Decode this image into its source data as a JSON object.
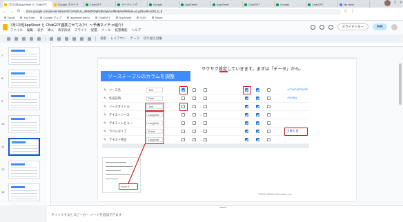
{
  "browser": {
    "tabs": [
      {
        "label": "7月13日]AppSheet と ChatGPT",
        "color": "#f4b400",
        "active": true
      },
      {
        "label": "Google スライド",
        "color": "#fbbc04",
        "active": false
      },
      {
        "label": "ChatGPT",
        "color": "#0f9d58",
        "active": false
      },
      {
        "label": "ライティング",
        "color": "#0f9d58",
        "active": false
      },
      {
        "label": "Google",
        "color": "#0f9d58",
        "active": false
      },
      {
        "label": "AppSheet",
        "color": "#0f9d58",
        "active": false
      },
      {
        "label": "AppSheet",
        "color": "#0f9d58",
        "active": false
      },
      {
        "label": "ChatGPT",
        "color": "#0f9d58",
        "active": false
      },
      {
        "label": "Google",
        "color": "#0f9d58",
        "active": false
      },
      {
        "label": "ChatGPT",
        "color": "#0f9d58",
        "active": false
      },
      {
        "label": "My drive",
        "color": "#4285f4",
        "active": false
      }
    ],
    "url": "docs.google.com/presentation/d/1nAM4Uv_aBWZ8DpRdbnhjaAo0f8nB/edit#slide=id.g25ce9c4c0d_0_5",
    "bookmarks": [
      "Gmail",
      "YouTube",
      "Google マップ",
      "appsheet-demo",
      "ChatGPT",
      "AppSheet",
      "GAS",
      "Slides"
    ]
  },
  "app": {
    "doc_title": "7月13日]AppSheet と ChatGPT連携させてみた！〜予備ネイチャ紹介！",
    "menus": [
      "ファイル",
      "編集",
      "表示",
      "挿入",
      "表示形式",
      "スライド",
      "配置",
      "ツール",
      "拡張機能",
      "ヘルプ"
    ],
    "slideshow_label": "スライドショー",
    "share_label": "共有",
    "toolbar_items": [
      "背景",
      "レイアウト",
      "テーマ",
      "切り替え効果"
    ]
  },
  "filmstrip": {
    "slide_numbers": [
      "7",
      "8",
      "9",
      "10",
      "11",
      "12",
      "13"
    ],
    "selected": "11"
  },
  "slide": {
    "headline": "サクサク設定していきます。まずは「データ」から。",
    "banner": "ソーステーブルのカラムを調整",
    "rows": [
      {
        "name": "ソース名",
        "type": "Text",
        "checks": [
          true,
          false,
          false,
          true,
          true,
          false
        ],
        "tail": "=CONCATENATE"
      },
      {
        "name": "作成日時",
        "type": "Date",
        "checks": [
          false,
          false,
          false,
          true,
          true,
          false
        ],
        "tail": "=NOW()"
      },
      {
        "name": "ソースタイトル",
        "type": "Text",
        "checks": [
          false,
          false,
          false,
          true,
          true,
          false
        ],
        "tail": ""
      },
      {
        "name": "テキストソース",
        "type": "LongText",
        "checks": [
          false,
          false,
          false,
          true,
          true,
          false
        ],
        "tail": ""
      },
      {
        "name": "テキストレビュー",
        "type": "LongText",
        "checks": [
          false,
          false,
          false,
          true,
          true,
          false
        ],
        "tail": ""
      },
      {
        "name": "ラベルタイプ",
        "type": "Enum",
        "checks": [
          false,
          false,
          false,
          true,
          true,
          false
        ],
        "tail": "文章化 書"
      },
      {
        "name": "テキスト修正",
        "type": "LongText",
        "checks": [
          false,
          false,
          false,
          true,
          true,
          false
        ],
        "tail": ""
      }
    ],
    "mini_label": "Enum ▾",
    "copyright": "©2023 SANDA Information, Inc."
  },
  "notes": {
    "placeholder": "クリックするとスピーカー ノートを追加できます"
  }
}
